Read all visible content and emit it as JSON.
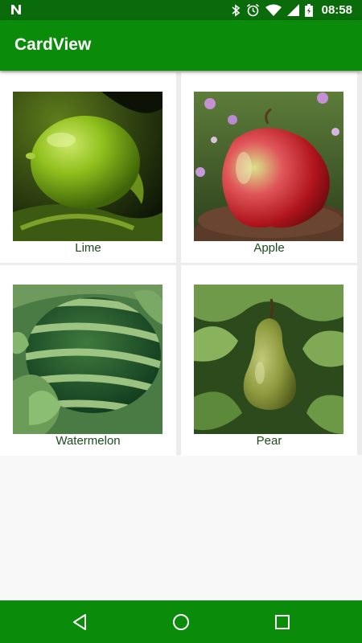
{
  "status_bar": {
    "time": "08:58",
    "icons": [
      "n-notification-icon",
      "bluetooth-icon",
      "alarm-icon",
      "wifi-icon",
      "signal-icon",
      "battery-charging-icon"
    ]
  },
  "app_bar": {
    "title": "CardView"
  },
  "cards": [
    {
      "label": "Lime",
      "image": "lime-image"
    },
    {
      "label": "Apple",
      "image": "apple-image"
    },
    {
      "label": "Watermelon",
      "image": "watermelon-image"
    },
    {
      "label": "Pear",
      "image": "pear-image"
    }
  ],
  "nav_bar": {
    "buttons": [
      "back-icon",
      "home-icon",
      "recents-icon"
    ]
  },
  "colors": {
    "status_bar": "#0a6b0a",
    "app_bar": "#0a8c0a",
    "nav_bar": "#0a8c0a",
    "label_text": "#1b4d1b"
  }
}
